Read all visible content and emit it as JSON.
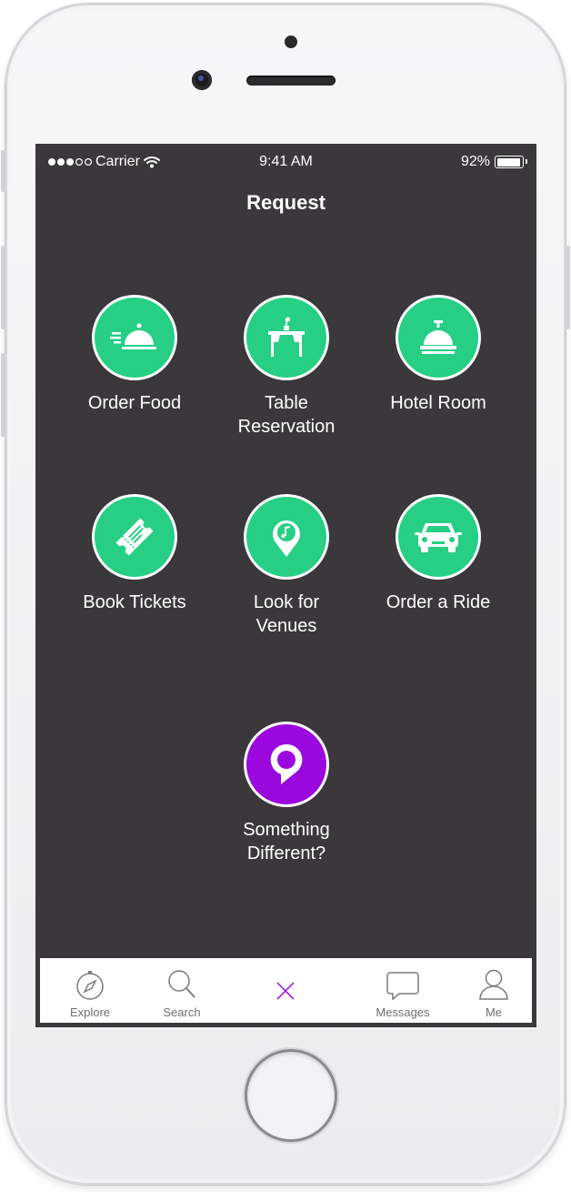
{
  "status_bar": {
    "carrier": "Carrier",
    "time": "9:41 AM",
    "battery": "92%"
  },
  "header": {
    "title": "Request"
  },
  "options": [
    {
      "label_1": "Order Food",
      "label_2": "",
      "icon": "food-cloche-icon"
    },
    {
      "label_1": "Table",
      "label_2": "Reservation",
      "icon": "dining-table-icon"
    },
    {
      "label_1": "Hotel Room",
      "label_2": "",
      "icon": "service-bell-icon"
    },
    {
      "label_1": "Book Tickets",
      "label_2": "",
      "icon": "ticket-icon"
    },
    {
      "label_1": "Look for",
      "label_2": "Venues",
      "icon": "music-pin-icon"
    },
    {
      "label_1": "Order a Ride",
      "label_2": "",
      "icon": "car-icon"
    },
    {
      "label_1": "Something",
      "label_2": "Different?",
      "icon": "chat-pin-icon"
    }
  ],
  "tabbar": {
    "items": [
      {
        "label": "Explore",
        "icon": "compass-icon"
      },
      {
        "label": "Search",
        "icon": "magnifier-icon"
      },
      {
        "label": "",
        "icon": "close-icon"
      },
      {
        "label": "Messages",
        "icon": "speech-bubble-icon"
      },
      {
        "label": "Me",
        "icon": "person-icon"
      }
    ]
  },
  "colors": {
    "screen_bg": "#3b383b",
    "accent_green": "#26cf84",
    "accent_purple": "#9b08de",
    "tab_active": "#9b08de"
  }
}
